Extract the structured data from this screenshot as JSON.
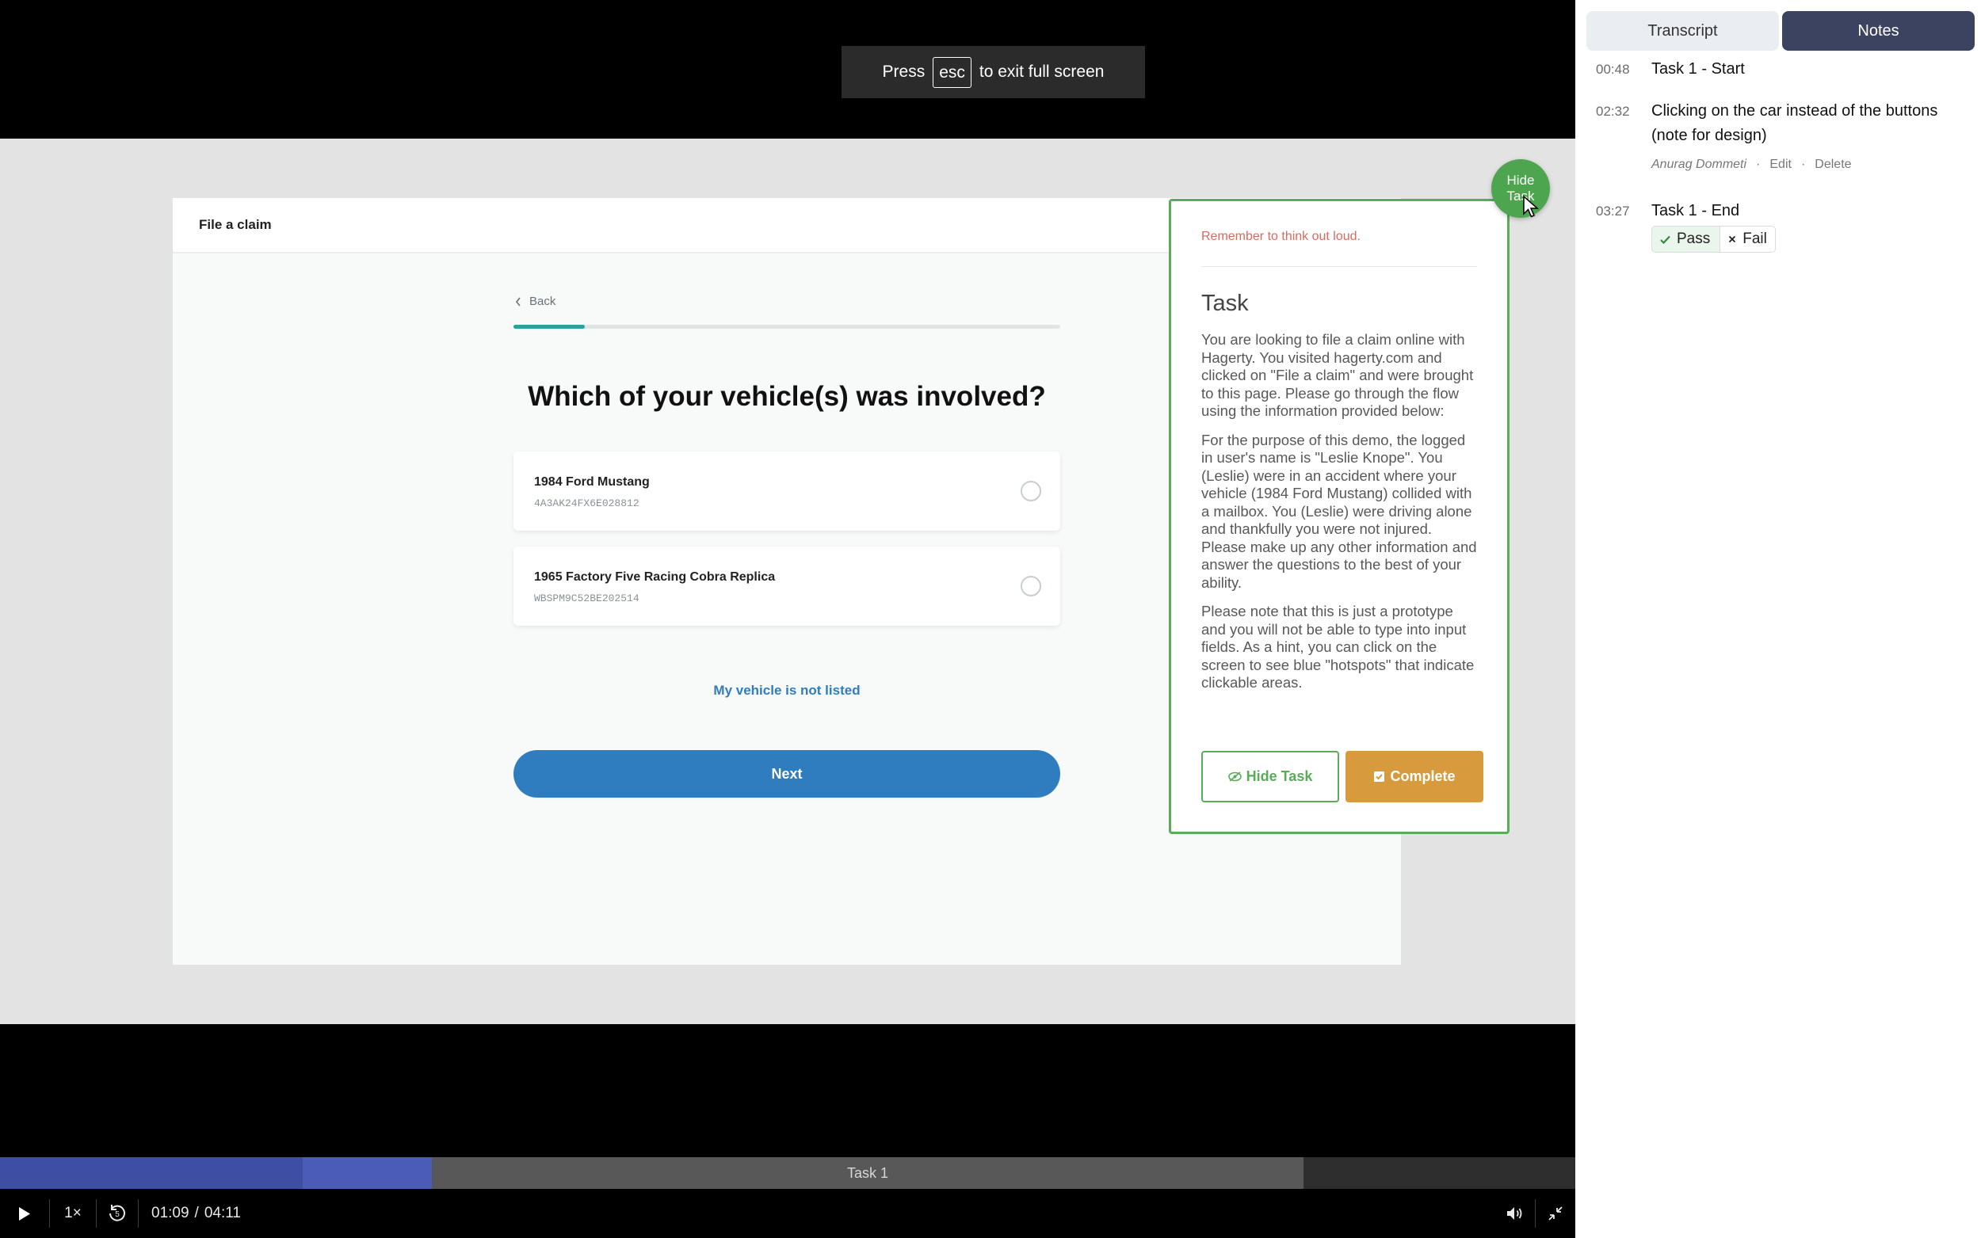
{
  "fullscreen_toast": {
    "press": "Press",
    "key": "esc",
    "rest": "to exit full screen"
  },
  "prototype": {
    "header_title": "File a claim",
    "back_label": "Back",
    "progress_fraction": 0.13,
    "question": "Which of your vehicle(s) was involved?",
    "vehicles": [
      {
        "name": "1984 Ford Mustang",
        "vin": "4A3AK24FX6E028812"
      },
      {
        "name": "1965 Factory Five Racing Cobra Replica",
        "vin": "WBSPM9C52BE202514"
      }
    ],
    "not_listed": "My vehicle is not listed",
    "next_label": "Next"
  },
  "task_panel": {
    "reminder": "Remember to think out loud.",
    "heading": "Task",
    "paragraphs": [
      "You are looking to file a claim online with Hagerty. You visited hagerty.com and clicked on \"File a claim\" and were brought to this page. Please go through the flow using the information provided below:",
      "For the purpose of this demo, the logged in user's name is \"Leslie Knope\". You (Leslie) were in an accident where your vehicle (1984 Ford Mustang) collided with a mailbox. You (Leslie) were driving alone and thankfully you were not injured. Please make up any other information and answer the questions to the best of your ability.",
      "Please note that this is just a prototype and you will not be able to type into input fields. As a hint, you can click on the screen to see blue \"hotspots\" that indicate clickable areas."
    ],
    "hide_task_label": "Hide Task",
    "complete_label": "Complete",
    "hide_bubble_label": "Hide Task",
    "accent_color": "#5aab5a",
    "complete_color": "#d79a3c"
  },
  "player": {
    "segment_label": "Task 1",
    "speed": "1×",
    "current_time": "01:09",
    "duration": "04:11",
    "time_separator": "/",
    "skip_seconds": "5",
    "progress_color": "#3d4ea3"
  },
  "side_panel": {
    "tabs": [
      {
        "label": "Transcript",
        "active": false
      },
      {
        "label": "Notes",
        "active": true
      }
    ],
    "notes": [
      {
        "time": "00:48",
        "text": "Task 1 - Start"
      },
      {
        "time": "02:32",
        "text": "Clicking on the car instead of the buttons (note for design)",
        "author": "Anurag Dommeti",
        "edit": "Edit",
        "delete": "Delete",
        "separator": "·"
      },
      {
        "time": "03:27",
        "text": "Task 1 - End",
        "pass": "Pass",
        "fail": "Fail"
      }
    ]
  }
}
